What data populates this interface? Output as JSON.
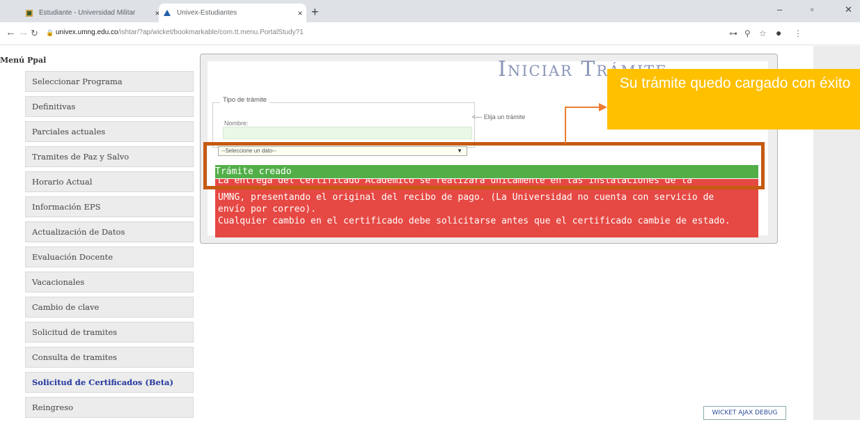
{
  "browser": {
    "tabs": [
      {
        "title": "Estudiante - Universidad Militar",
        "close": "×"
      },
      {
        "title": "Univex-Estudiantes",
        "close": "×"
      }
    ],
    "new_tab": "+",
    "window_controls": {
      "minimize": "–",
      "maximize": "▫",
      "close": "✕"
    },
    "url_host": "univex.umng.edu.co",
    "url_path": "/ishtar/?ap/wicket/bookmarkable/com.tt.menu.PortalStudy?1"
  },
  "sidebar": {
    "title": "Menú Ppal",
    "items": [
      {
        "label": "Seleccionar Programa"
      },
      {
        "label": "Definitivas"
      },
      {
        "label": "Parciales actuales"
      },
      {
        "label": "Tramites de Paz y Salvo"
      },
      {
        "label": "Horario Actual"
      },
      {
        "label": "Información EPS"
      },
      {
        "label": "Actualización de Datos"
      },
      {
        "label": "Evaluación Docente"
      },
      {
        "label": "Vacacionales"
      },
      {
        "label": "Cambio de clave"
      },
      {
        "label": "Solicitud de tramites"
      },
      {
        "label": "Consulta de tramites"
      },
      {
        "label": "Solicitud de Certificados (Beta)"
      },
      {
        "label": "Reingreso"
      }
    ],
    "active_index": 12
  },
  "main": {
    "title": "Iniciar Trámite",
    "fieldset_legend": "Tipo de trámite",
    "name_label": "Nombre:",
    "name_value": "",
    "select_value": "--Seleccione un dato--",
    "pick_hint": "<--- Elija un trámite",
    "success_message": "Trámite creado",
    "error_lines": [
      "La entrega del Certificado Académico se realizara únicamente en las instalaciones de la",
      "UMNG, presentando el original del recibo de pago. (La Universidad no cuenta con servicio de",
      "envío por correo).",
      "Cualquier cambio en el certificado debe solicitarse antes que el certificado cambie de estado."
    ]
  },
  "annotation": {
    "callout_text": "Su trámite quedo cargado con éxito",
    "highlight_color": "#c55a11",
    "callout_color": "#ffc000"
  },
  "debug_button": "WICKET AJAX DEBUG",
  "colors": {
    "success": "#52af48",
    "error": "#e64843"
  }
}
